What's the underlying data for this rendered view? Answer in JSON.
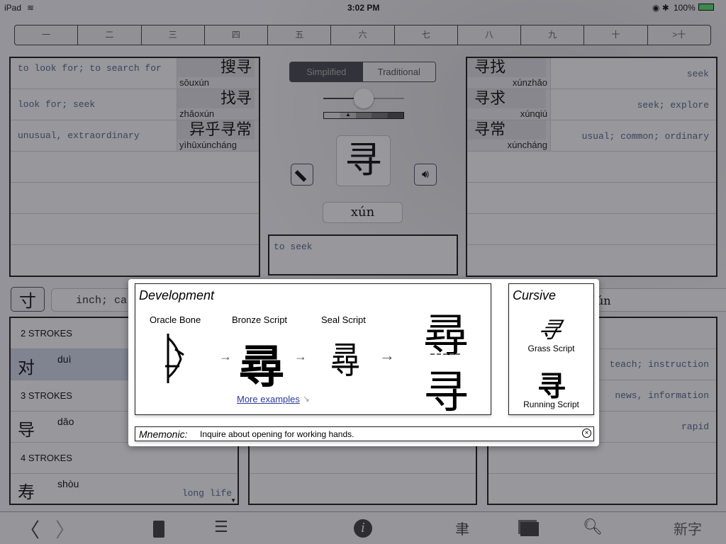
{
  "status": {
    "device": "iPad",
    "time": "3:02 PM",
    "battery": "100%"
  },
  "stroke_tabs": [
    "一",
    "二",
    "三",
    "四",
    "五",
    "六",
    "七",
    "八",
    "九",
    "十",
    ">十"
  ],
  "left_words": [
    {
      "def": "to look for; to search for",
      "chars": "搜寻",
      "pinyin": "sōuxún"
    },
    {
      "def": "look for; seek",
      "chars": "找寻",
      "pinyin": "zhǎoxún"
    },
    {
      "def": "unusual, extraordinary",
      "chars": "异乎寻常",
      "pinyin": "yìhūxúncháng"
    }
  ],
  "right_words": [
    {
      "def": "seek",
      "chars": "寻找",
      "pinyin": "xúnzhǎo"
    },
    {
      "def": "seek; explore",
      "chars": "寻求",
      "pinyin": "xúnqiú"
    },
    {
      "def": "usual; common; ordinary",
      "chars": "寻常",
      "pinyin": "xúncháng"
    }
  ],
  "center": {
    "seg_simplified": "Simplified",
    "seg_traditional": "Traditional",
    "character": "寻",
    "pinyin": "xún",
    "definition": "to seek",
    "slider_value": 0.5
  },
  "radical": {
    "char": "寸",
    "meaning": "inch; ca",
    "right_field": "ún"
  },
  "stroke_list": [
    {
      "header": "2 STROKES"
    },
    {
      "char": "对",
      "pinyin": "duì",
      "def": "",
      "selected": true
    },
    {
      "header": "3 STROKES"
    },
    {
      "char": "导",
      "pinyin": "dǎo",
      "def": ""
    },
    {
      "header": "4 STROKES"
    },
    {
      "char": "寿",
      "pinyin": "shòu",
      "def": "long life"
    }
  ],
  "right_list": [
    "",
    "teach; instruction",
    "news, information",
    "rapid",
    "",
    ""
  ],
  "popup": {
    "development_title": "Development",
    "stages": [
      "Oracle Bone",
      "Bronze Script",
      "Seal Script"
    ],
    "traditional": "尋",
    "simplified": "寻",
    "more_examples": "More examples",
    "cursive_title": "Cursive",
    "grass": "Grass Script",
    "running": "Running Script",
    "mnemonic_label": "Mnemonic:",
    "mnemonic_text": "Inquire about opening for working hands."
  },
  "toolbar": {
    "new_chars": "新字"
  },
  "colors": {
    "battery": "#4cd964",
    "link": "#2a3a9a",
    "selected_row": "#c8d0e0"
  }
}
